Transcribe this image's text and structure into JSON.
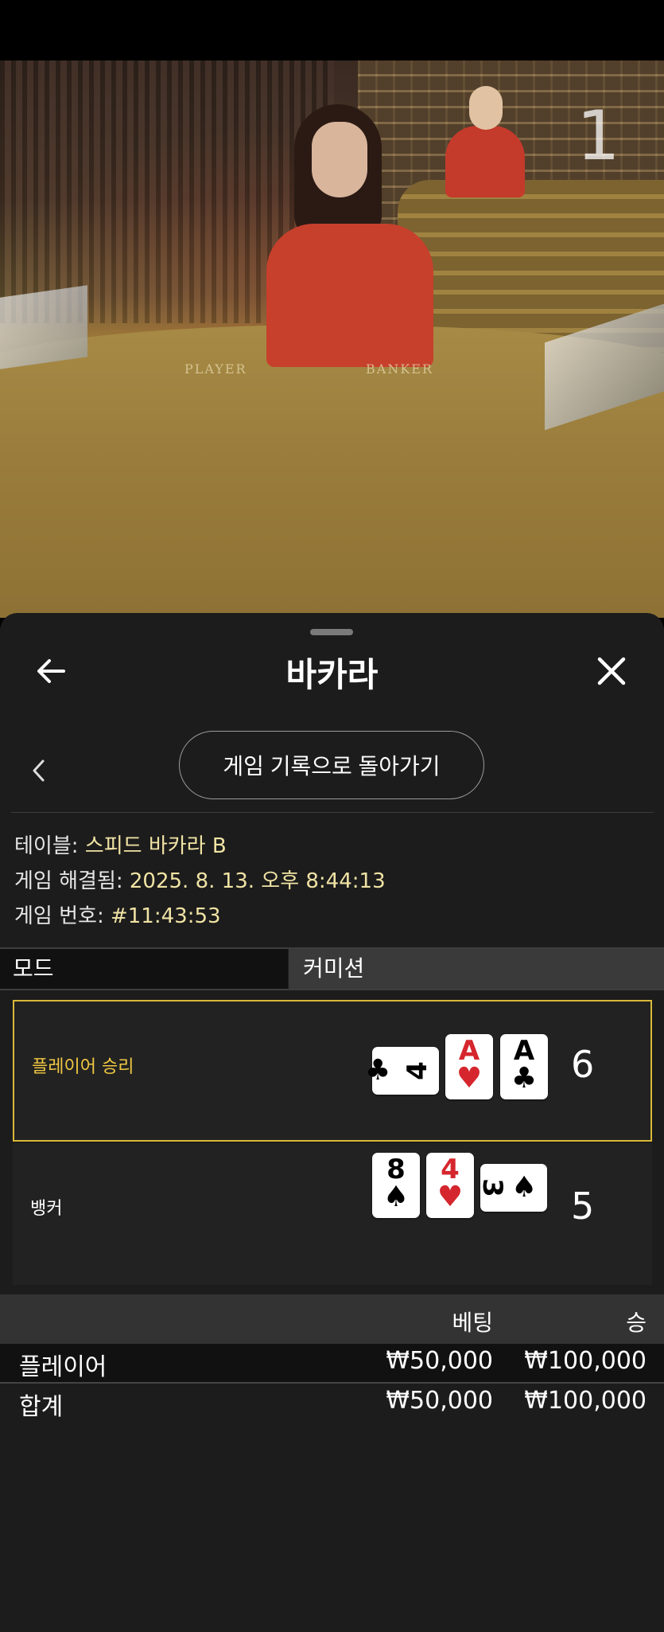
{
  "video": {
    "table_label_player": "PLAYER",
    "table_label_banker": "BANKER",
    "corner_number": "1"
  },
  "header": {
    "title": "바카라",
    "back_icon": "arrow-left-icon",
    "close_icon": "close-icon"
  },
  "subnav": {
    "back_icon": "chevron-left-icon",
    "return_button": "게임 기록으로 돌아가기"
  },
  "info": {
    "table_label": "테이블: ",
    "table_value": "스피드 바카라 B",
    "resolved_label": "게임 해결됨: ",
    "resolved_value": "2025. 8. 13. 오후 8:44:13",
    "game_no_label": "게임 번호: ",
    "game_no_value": "#11:43:53"
  },
  "tabs": [
    "모드",
    "커미션"
  ],
  "results": {
    "player": {
      "label": "플레이어 승리",
      "score": "6",
      "cards": [
        {
          "rank": "4",
          "suit": "♣",
          "color": "black",
          "orientation": "horizontal"
        },
        {
          "rank": "A",
          "suit": "♥",
          "color": "red",
          "orientation": "vertical"
        },
        {
          "rank": "A",
          "suit": "♣",
          "color": "black",
          "orientation": "vertical"
        }
      ]
    },
    "banker": {
      "label": "뱅커",
      "score": "5",
      "cards": [
        {
          "rank": "8",
          "suit": "♠",
          "color": "black",
          "orientation": "vertical"
        },
        {
          "rank": "4",
          "suit": "♥",
          "color": "red",
          "orientation": "vertical"
        },
        {
          "rank": "3",
          "suit": "♠",
          "color": "black",
          "orientation": "horizontal"
        }
      ]
    }
  },
  "bets_table": {
    "headers": {
      "bet": "베팅",
      "win": "승"
    },
    "rows": [
      {
        "name": "플레이어",
        "bet": "₩50,000",
        "win": "₩100,000"
      },
      {
        "name": "합계",
        "bet": "₩50,000",
        "win": "₩100,000"
      }
    ]
  },
  "colors": {
    "winner_border": "#d9b938",
    "winner_label": "#f1c842",
    "info_value": "#f0e3a4",
    "card_red": "#d5262e"
  }
}
